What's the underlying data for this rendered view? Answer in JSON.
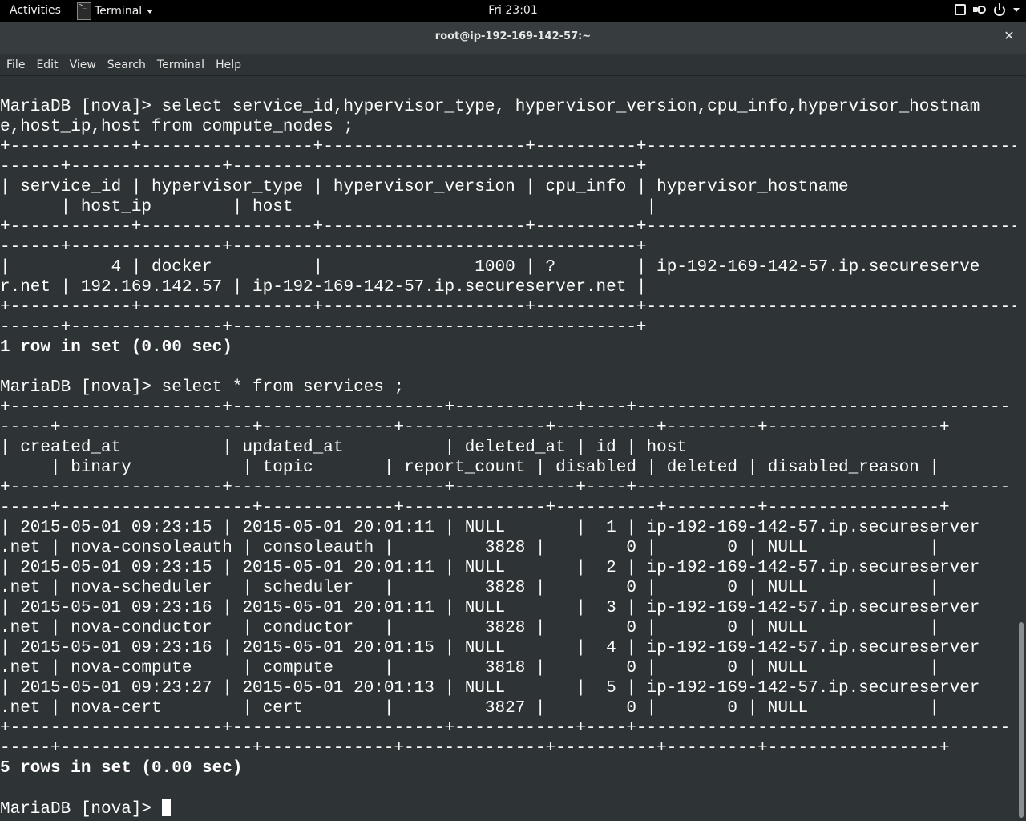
{
  "topbar": {
    "activities": "Activities",
    "app_name": "Terminal",
    "clock": "Fri 23:01"
  },
  "window": {
    "title": "root@ip-192-169-142-57:~"
  },
  "menu": [
    "File",
    "Edit",
    "View",
    "Search",
    "Terminal",
    "Help"
  ],
  "terminal": {
    "lines": [
      {
        "text": "MariaDB [nova]> select service_id,hypervisor_type, hypervisor_version,cpu_info,hypervisor_hostnam",
        "bold": false
      },
      {
        "text": "e,host_ip,host from compute_nodes ;",
        "bold": false
      },
      {
        "text": "+------------+-----------------+--------------------+----------+-------------------------------------",
        "bold": false
      },
      {
        "text": "------+---------------+----------------------------------------+",
        "bold": false
      },
      {
        "text": "| service_id | hypervisor_type | hypervisor_version | cpu_info | hypervisor_hostname",
        "bold": false
      },
      {
        "text": "      | host_ip        | host                                   |",
        "bold": false
      },
      {
        "text": "+------------+-----------------+--------------------+----------+-------------------------------------",
        "bold": false
      },
      {
        "text": "------+---------------+----------------------------------------+",
        "bold": false
      },
      {
        "text": "|          4 | docker          |               1000 | ?        | ip-192-169-142-57.ip.secureserve",
        "bold": false
      },
      {
        "text": "r.net | 192.169.142.57 | ip-192-169-142-57.ip.secureserver.net |",
        "bold": false
      },
      {
        "text": "+------------+-----------------+--------------------+----------+-------------------------------------",
        "bold": false
      },
      {
        "text": "------+---------------+----------------------------------------+",
        "bold": false
      },
      {
        "text": "1 row in set (0.00 sec)",
        "bold": true
      },
      {
        "text": "",
        "bold": false
      },
      {
        "text": "MariaDB [nova]> select * from services ;",
        "bold": false
      },
      {
        "text": "+---------------------+---------------------+------------+----+-------------------------------------",
        "bold": false
      },
      {
        "text": "-----+-------------------+-------------+--------------+----------+---------+-----------------+",
        "bold": false
      },
      {
        "text": "| created_at          | updated_at          | deleted_at | id | host",
        "bold": false
      },
      {
        "text": "     | binary           | topic       | report_count | disabled | deleted | disabled_reason |",
        "bold": false
      },
      {
        "text": "+---------------------+---------------------+------------+----+-------------------------------------",
        "bold": false
      },
      {
        "text": "-----+-------------------+-------------+--------------+----------+---------+-----------------+",
        "bold": false
      },
      {
        "text": "| 2015-05-01 09:23:15 | 2015-05-01 20:01:11 | NULL       |  1 | ip-192-169-142-57.ip.secureserver",
        "bold": false
      },
      {
        "text": ".net | nova-consoleauth | consoleauth |         3828 |        0 |       0 | NULL            |",
        "bold": false
      },
      {
        "text": "| 2015-05-01 09:23:15 | 2015-05-01 20:01:11 | NULL       |  2 | ip-192-169-142-57.ip.secureserver",
        "bold": false
      },
      {
        "text": ".net | nova-scheduler   | scheduler   |         3828 |        0 |       0 | NULL            |",
        "bold": false
      },
      {
        "text": "| 2015-05-01 09:23:16 | 2015-05-01 20:01:11 | NULL       |  3 | ip-192-169-142-57.ip.secureserver",
        "bold": false
      },
      {
        "text": ".net | nova-conductor   | conductor   |         3828 |        0 |       0 | NULL            |",
        "bold": false
      },
      {
        "text": "| 2015-05-01 09:23:16 | 2015-05-01 20:01:15 | NULL       |  4 | ip-192-169-142-57.ip.secureserver",
        "bold": false
      },
      {
        "text": ".net | nova-compute     | compute     |         3818 |        0 |       0 | NULL            |",
        "bold": false
      },
      {
        "text": "| 2015-05-01 09:23:27 | 2015-05-01 20:01:13 | NULL       |  5 | ip-192-169-142-57.ip.secureserver",
        "bold": false
      },
      {
        "text": ".net | nova-cert        | cert        |         3827 |        0 |       0 | NULL            |",
        "bold": false
      },
      {
        "text": "+---------------------+---------------------+------------+----+-------------------------------------",
        "bold": false
      },
      {
        "text": "-----+-------------------+-------------+--------------+----------+---------+-----------------+",
        "bold": false
      },
      {
        "text": "5 rows in set (0.00 sec)",
        "bold": true
      },
      {
        "text": "",
        "bold": false
      }
    ],
    "prompt": "MariaDB [nova]> "
  }
}
